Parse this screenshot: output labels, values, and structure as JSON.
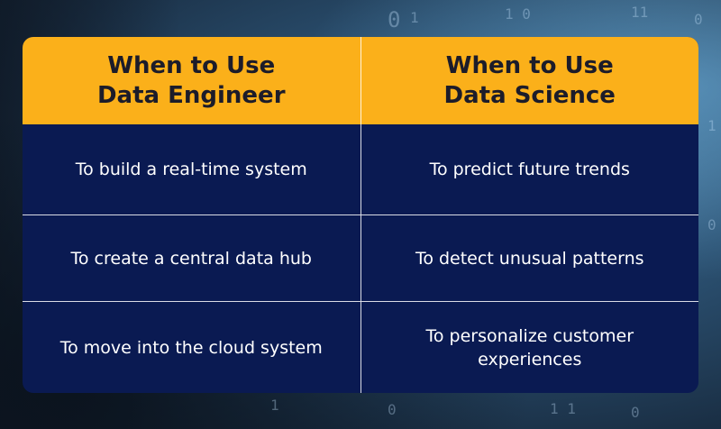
{
  "table": {
    "headers": [
      [
        "When to Use",
        "Data Engineer"
      ],
      [
        "When to Use",
        "Data Science"
      ]
    ],
    "rows": [
      [
        "To build a real-time system",
        "To predict future trends"
      ],
      [
        "To create a central data hub",
        "To detect unusual patterns"
      ],
      [
        "To move into the cloud system",
        "To personalize customer experiences"
      ]
    ]
  },
  "colors": {
    "header_bg": "#fbb01a",
    "header_text": "#1c1c2a",
    "body_bg": "#0a1a52",
    "body_text": "#ffffff"
  }
}
